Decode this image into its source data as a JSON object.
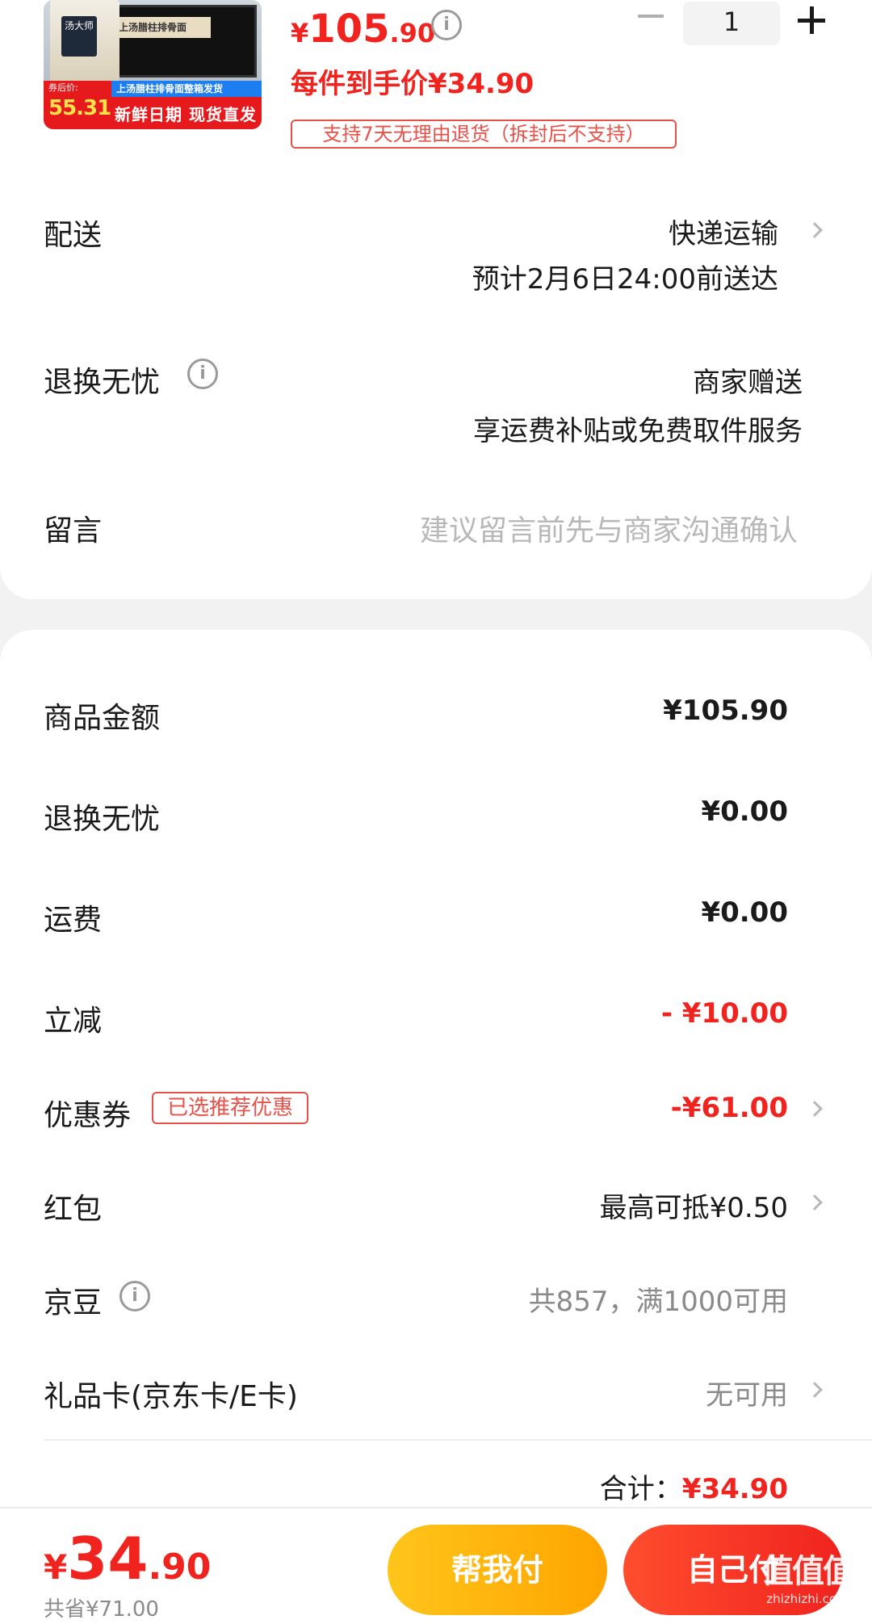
{
  "product": {
    "thumb": {
      "box_title": "上汤腊柱排骨面",
      "cup_brand": "汤大师",
      "blue_banner": "上汤腊柱排骨面整箱发货",
      "price_label": "券后价:",
      "price_value": "55.31",
      "slogan": "新鲜日期 现货直发"
    },
    "price_currency": "¥",
    "price_int": "105",
    "price_dec": ".90",
    "info_icon": "i",
    "quantity": "1",
    "unit_price": "每件到手价¥34.90",
    "return_policy": "支持7天无理由退货（拆封后不支持）"
  },
  "delivery": {
    "label": "配送",
    "method": "快递运输",
    "eta": "预计2月6日24:00前送达"
  },
  "return_service": {
    "label": "退换无忧",
    "provider": "商家赠送",
    "desc": "享运费补贴或免费取件服务"
  },
  "message": {
    "label": "留言",
    "placeholder": "建议留言前先与商家沟通确认"
  },
  "summary": {
    "rows": [
      {
        "label": "商品金额",
        "value": "¥105.90"
      },
      {
        "label": "退换无忧",
        "value": "¥0.00"
      },
      {
        "label": "运费",
        "value": "¥0.00"
      },
      {
        "label": "立减",
        "value": "- ¥10.00"
      },
      {
        "label": "优惠券",
        "badge": "已选推荐优惠",
        "value": "-¥61.00"
      },
      {
        "label": "红包",
        "value": "最高可抵¥0.50"
      },
      {
        "label": "京豆",
        "value": "共857，满1000可用"
      },
      {
        "label": "礼品卡(京东卡/E卡)",
        "value": "无可用"
      }
    ],
    "total_label": "合计：",
    "total_value": "¥34.90"
  },
  "bottom_bar": {
    "price_currency": "¥",
    "price_int": "34",
    "price_dec": ".90",
    "saved": "共省¥71.00",
    "help_pay": "帮我付",
    "self_pay": "自己付"
  },
  "watermark": {
    "logo": "值值值",
    "site": "zhizhizhi.com"
  },
  "colors": {
    "accent_red": "#f0231e",
    "help_yellow": "#ffb000"
  }
}
